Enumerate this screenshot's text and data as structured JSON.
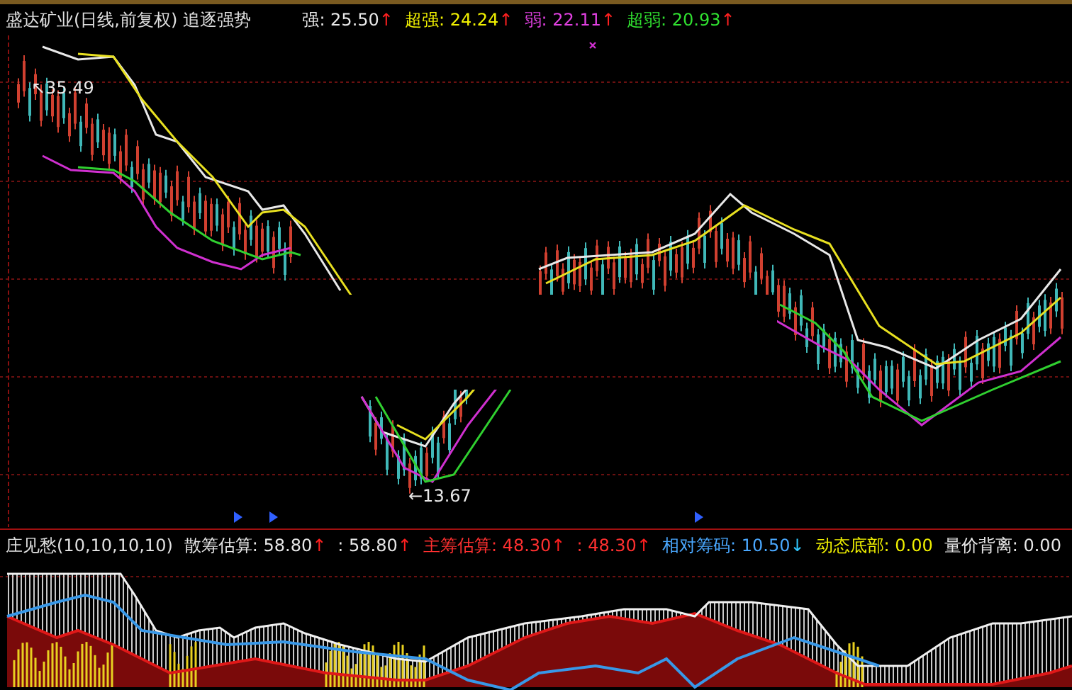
{
  "main_chart": {
    "title": "盛达矿业(日线,前复权)",
    "indicator": "追逐强势",
    "readings": [
      {
        "label": "强:",
        "value": "25.50",
        "arrow": "↑",
        "color": "#e8e8e8"
      },
      {
        "label": "超强:",
        "value": "24.24",
        "arrow": "↑",
        "color": "#f0f000"
      },
      {
        "label": "弱:",
        "value": "22.11",
        "arrow": "↑",
        "color": "#e040e0"
      },
      {
        "label": "超弱:",
        "value": "20.93",
        "arrow": "↑",
        "color": "#30e030"
      }
    ],
    "price_labels": [
      {
        "text": "↖35.49"
      },
      {
        "text": "←13.67"
      }
    ]
  },
  "sub_chart": {
    "indicator": "庄见愁(10,10,10,10)",
    "readings": [
      {
        "label": "散筹估算:",
        "value": "58.80",
        "arrow": "↑",
        "color": "#e8e8e8"
      },
      {
        "label": ":",
        "value": "58.80",
        "arrow": "↑",
        "color": "#e8e8e8"
      },
      {
        "label": "主筹估算:",
        "value": "48.30",
        "arrow": "↑",
        "color": "#ff3030"
      },
      {
        "label": ":",
        "value": "48.30",
        "arrow": "↑",
        "color": "#ff3030"
      },
      {
        "label": "相对筹码:",
        "value": "10.50",
        "arrow": "↓",
        "color": "#4aa8ff"
      },
      {
        "label": "动态底部:",
        "value": "0.00",
        "color": "#f0f000"
      },
      {
        "label": "量价背离:",
        "value": "0.00",
        "color": "#e8e8e8"
      }
    ]
  }
}
